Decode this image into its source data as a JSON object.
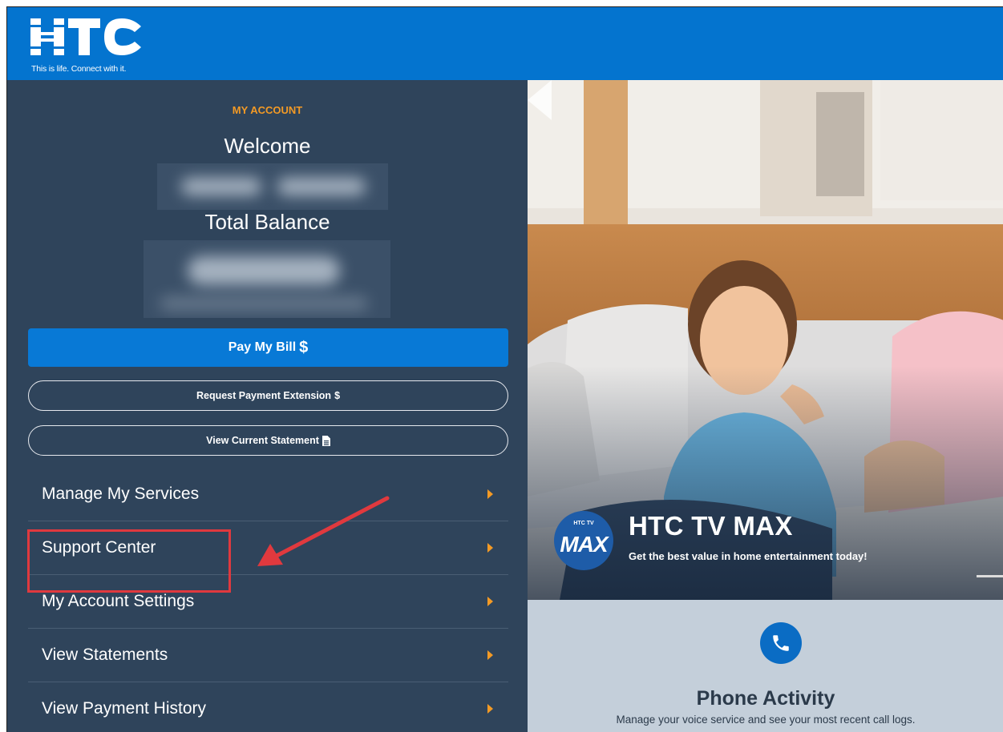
{
  "header": {
    "logo_text": "HTC",
    "tagline": "This is life. Connect with it."
  },
  "account": {
    "section_label": "MY ACCOUNT",
    "welcome_label": "Welcome",
    "balance_label": "Total Balance"
  },
  "buttons": {
    "pay_bill": "Pay My Bill",
    "pay_bill_icon": "$",
    "payment_extension": "Request Payment Extension",
    "payment_extension_icon": "$",
    "view_statement": "View Current Statement"
  },
  "menu": [
    {
      "label": "Manage My Services"
    },
    {
      "label": "Support Center"
    },
    {
      "label": "My Account Settings"
    },
    {
      "label": "View Statements"
    },
    {
      "label": "View Payment History"
    }
  ],
  "hero": {
    "badge_small": "HTC TV",
    "badge_big": "MAX",
    "title": "HTC TV MAX",
    "subtitle": "Get the best value in home entertainment today!"
  },
  "phone_panel": {
    "title": "Phone Activity",
    "description": "Manage your voice service and see your most recent call logs."
  },
  "colors": {
    "header_blue": "#0474cf",
    "sidebar_bg": "#2f445b",
    "accent_orange": "#f39a25",
    "button_blue": "#0879d6",
    "annotation_red": "#e0393e"
  }
}
